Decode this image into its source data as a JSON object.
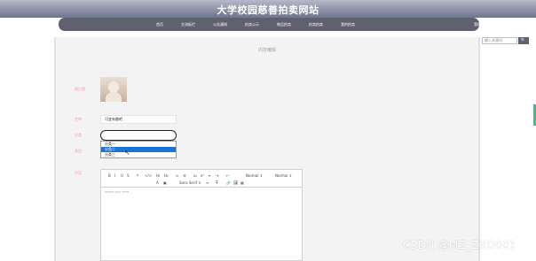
{
  "header": {
    "title": "大学校园慈善拍卖网站"
  },
  "nav": {
    "items": [
      "首页",
      "交流板栏",
      "公告通知",
      "拍卖公示",
      "物品拍卖",
      "拍卖拍卖",
      "我的拍卖"
    ],
    "right": "我的 ⌄"
  },
  "search": {
    "placeholder": "输入关键词",
    "button": "🔍"
  },
  "page": {
    "title": "内容编辑"
  },
  "form": {
    "label_image": "图片图",
    "label_name": "名称",
    "label_category": "分类",
    "label_type": "类型",
    "label_content": "内容",
    "name_value": "可变有趣吧",
    "options": [
      "分类一",
      "分类二",
      "分类三"
    ],
    "selected_index": 1
  },
  "editor": {
    "toolbar_row1": [
      "B",
      "I",
      "U",
      "S",
      "❝",
      "</>",
      "H₁",
      "H₂",
      "≡",
      "☰",
      "x₂",
      "x²",
      "⇤",
      "⇥",
      "↵",
      "Normal ⇕",
      "Normal ⇕"
    ],
    "toolbar_row2": [
      "A",
      "▣",
      "Sans Serif ⇕",
      "≡",
      "T̶",
      "🔗",
      "🖼",
      "▦"
    ],
    "placeholder": "Insert text here ..."
  },
  "watermark": "CSDN @MZ_ZXD001",
  "colors": {
    "label": "#f0a3ad",
    "nav_bar": "#5f6170",
    "selected": "#1e73d6"
  }
}
